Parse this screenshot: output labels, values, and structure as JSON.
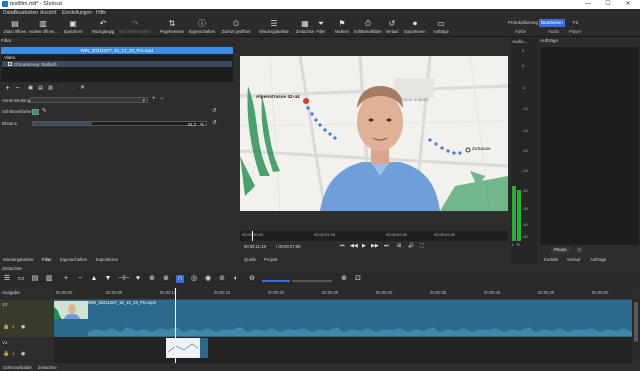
{
  "window": {
    "title": "testfilm.mlt* - Shotcut",
    "minimize": "—",
    "maximize": "☐",
    "close": "✕"
  },
  "menu": [
    "Datei",
    "Bearbeiten",
    "Ansicht",
    "Einstellungen",
    "Hilfe"
  ],
  "toolbar": {
    "items": [
      {
        "label": "Datei öffnen",
        "icon": "folder-open-icon",
        "glyph": "▤"
      },
      {
        "label": "Andere öffnen...",
        "icon": "open-other-icon",
        "glyph": "▥"
      },
      {
        "label": "Speichern",
        "icon": "save-icon",
        "glyph": "▣"
      },
      {
        "label": "Rückgängig",
        "icon": "undo-icon",
        "glyph": "↶"
      },
      {
        "label": "Wiederherstellen",
        "icon": "redo-icon",
        "glyph": "↷"
      },
      {
        "label": "Pegelmesser",
        "icon": "peak-meter-icon",
        "glyph": "⇅"
      },
      {
        "label": "Eigenschaften",
        "icon": "properties-icon",
        "glyph": "ⓘ"
      },
      {
        "label": "Zuletzt geöffnet",
        "icon": "recent-icon",
        "glyph": "⏲"
      },
      {
        "label": "Wiedergabeliste",
        "icon": "playlist-icon",
        "glyph": "☰"
      },
      {
        "label": "Zeitachse",
        "icon": "timeline-icon",
        "glyph": "▦"
      },
      {
        "label": "Filter",
        "icon": "filter-icon",
        "glyph": "⏷"
      },
      {
        "label": "Marken",
        "icon": "markers-icon",
        "glyph": "⚑"
      },
      {
        "label": "Schlüsselbilder",
        "icon": "keyframes-icon",
        "glyph": "⏱"
      },
      {
        "label": "Verlauf",
        "icon": "history-icon",
        "glyph": "↺"
      },
      {
        "label": "Exportieren",
        "icon": "export-icon",
        "glyph": "⏺"
      },
      {
        "label": "Aufträge",
        "icon": "jobs-icon",
        "glyph": "▭"
      }
    ],
    "layouts": [
      {
        "label": "Protokollierung",
        "active": false
      },
      {
        "label": "Bearbeiten",
        "active": true
      },
      {
        "label": "Fit",
        "active": false
      }
    ],
    "layout_sub": [
      "Farbe",
      "Audio",
      "Player"
    ]
  },
  "filter_panel": {
    "title": "Filter",
    "clip_name": "WIN_20211207_16_13_23_Pro.mp4",
    "group_label": "Video",
    "filters": [
      {
        "name": "Chroma Key: Einfach",
        "enabled": false
      }
    ],
    "preset_label": "Voreinstellung",
    "key_color_label": "Schlüsselfarbe",
    "key_color": "#1ba66b",
    "distance_label": "Distanz",
    "distance_value": "34,2",
    "distance_unit": "%",
    "distance_fraction": 0.342,
    "tabs": [
      "Wiedergabeliste",
      "Filter",
      "Eigenschaften",
      "Exportieren"
    ]
  },
  "player": {
    "map_labels": {
      "start": "Alpenstrasse 42-44",
      "end": "Zuhause",
      "place": "Sharon Imbach"
    },
    "ruler_labels": [
      "00:00:00:00",
      "00:00:01:00",
      "00:00:02:00",
      "00:00:03:00"
    ],
    "position": "00:00:11:19",
    "duration": "/ 00:00:27:05",
    "tabs": [
      "Quelle",
      "Projekt"
    ],
    "transport": [
      "⏮",
      "◀◀",
      "▶",
      "▶▶",
      "⏭",
      "⊞",
      "🔊",
      "⛶"
    ]
  },
  "audio_meter": {
    "title": "Audio...",
    "db_labels": [
      "3",
      "0",
      "-5",
      "-10",
      "-15",
      "-20",
      "-25",
      "-30",
      "-35",
      "-40",
      "-50"
    ],
    "channels": [
      {
        "name": "L",
        "level_fraction": 0.28
      },
      {
        "name": "R",
        "level_fraction": 0.26
      }
    ]
  },
  "history": {
    "title": "Aufträge",
    "pause_button": "Pause",
    "menu_button": "≡",
    "tabs": [
      "Kodieln",
      "Verlauf",
      "Aufträge"
    ]
  },
  "timeline": {
    "title": "Zeitachse",
    "output_label": "Ausgabe",
    "tracks": [
      {
        "name": "V2"
      },
      {
        "name": "V1"
      }
    ],
    "ruler_labels": [
      "00:00:00",
      "00:00:05",
      "00:00:10",
      "00:00:15",
      "00:00:20",
      "00:00:25",
      "00:00:30",
      "00:00:35",
      "00:00:40",
      "00:00:45",
      "00:00:50"
    ],
    "main_clip_name": "WIN_20211207_16_13_23_Pro.mp4",
    "tools": [
      "☰",
      "▭",
      "▤",
      "▥",
      "+",
      "−",
      "▲",
      "▼",
      "⊣⊢",
      "♥",
      "⊕",
      "⊗",
      "∩",
      "◎",
      "◉",
      "⊘",
      "◐",
      "⊖",
      "⊕",
      "⊡"
    ]
  },
  "status_tabs": [
    "Schlüsselbilder",
    "Zeitachse"
  ]
}
